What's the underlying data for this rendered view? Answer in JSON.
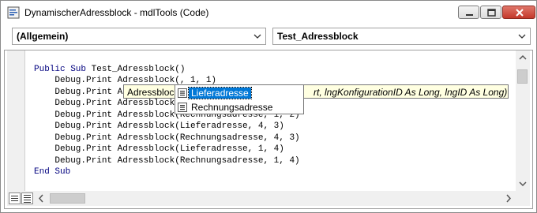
{
  "window": {
    "title": "DynamischerAdressblock - mdlTools (Code)"
  },
  "object_combo": {
    "value": "(Allgemein)"
  },
  "procedure_combo": {
    "value": "Test_Adressblock"
  },
  "code": {
    "lines": [
      "",
      "Public Sub Test_Adressblock()",
      "    Debug.Print Adressblock(, 1, 1)",
      "    Debug.Print Adressblock(",
      "    Debug.Print Adressblock(",
      "    Debug.Print Adressblock(Rechnungsadresse, 1, 2)",
      "    Debug.Print Adressblock(Lieferadresse, 4, 3)",
      "    Debug.Print Adressblock(Rechnungsadresse, 4, 3)",
      "    Debug.Print Adressblock(Lieferadresse, 1, 4)",
      "    Debug.Print Adressblock(Rechnungsadresse, 1, 4)",
      "End Sub"
    ]
  },
  "tooltip": {
    "left_text": "Adressblock(",
    "right_text": "rt, lngKonfigurationID As Long, lngID As Long)"
  },
  "autocomplete": {
    "items": [
      {
        "label": "Lieferadresse",
        "icon": "enum-member-icon",
        "selected": true
      },
      {
        "label": "Rechnungsadresse",
        "icon": "enum-member-icon",
        "selected": false
      }
    ]
  },
  "colors": {
    "keyword": "#00007f",
    "selection": "#0078d7",
    "tooltip_bg": "#ffffe1",
    "close_button": "#c3392b"
  }
}
